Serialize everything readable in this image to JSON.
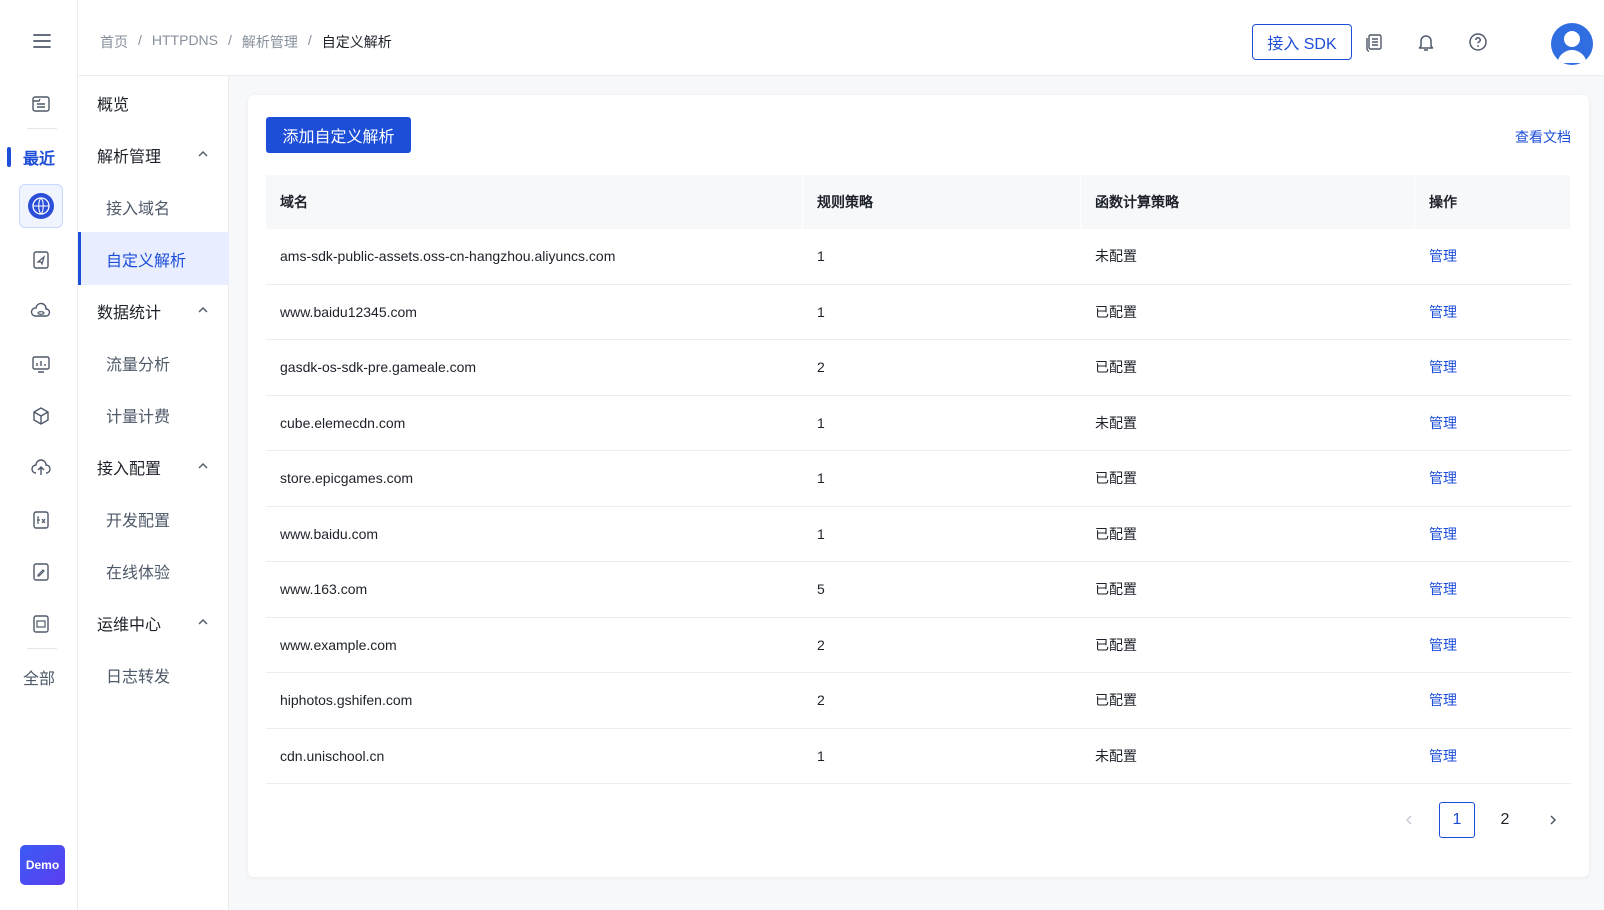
{
  "header": {
    "breadcrumb": [
      "首页",
      "HTTPDNS",
      "解析管理",
      "自定义解析"
    ],
    "sdk_button": "接入 SDK"
  },
  "rail": {
    "recent": "最近",
    "all": "全部",
    "demo": "Demo"
  },
  "subnav": {
    "overview": "概览",
    "groups": [
      {
        "label": "解析管理",
        "children": [
          "接入域名",
          "自定义解析"
        ]
      },
      {
        "label": "数据统计",
        "children": [
          "流量分析",
          "计量计费"
        ]
      },
      {
        "label": "接入配置",
        "children": [
          "开发配置",
          "在线体验"
        ]
      },
      {
        "label": "运维中心",
        "children": [
          "日志转发"
        ]
      }
    ]
  },
  "main": {
    "add_button": "添加自定义解析",
    "doc_link": "查看文档",
    "columns": [
      "域名",
      "规则策略",
      "函数计算策略",
      "操作"
    ],
    "rows": [
      {
        "domain": "ams-sdk-public-assets.oss-cn-hangzhou.aliyuncs.com",
        "rules": "1",
        "func": "未配置",
        "action": "管理"
      },
      {
        "domain": "www.baidu12345.com",
        "rules": "1",
        "func": "已配置",
        "action": "管理"
      },
      {
        "domain": "gasdk-os-sdk-pre.gameale.com",
        "rules": "2",
        "func": "已配置",
        "action": "管理"
      },
      {
        "domain": "cube.elemecdn.com",
        "rules": "1",
        "func": "未配置",
        "action": "管理"
      },
      {
        "domain": "store.epicgames.com",
        "rules": "1",
        "func": "已配置",
        "action": "管理"
      },
      {
        "domain": "www.baidu.com",
        "rules": "1",
        "func": "已配置",
        "action": "管理"
      },
      {
        "domain": "www.163.com",
        "rules": "5",
        "func": "已配置",
        "action": "管理"
      },
      {
        "domain": "www.example.com",
        "rules": "2",
        "func": "已配置",
        "action": "管理"
      },
      {
        "domain": "hiphotos.gshifen.com",
        "rules": "2",
        "func": "已配置",
        "action": "管理"
      },
      {
        "domain": "cdn.unischool.cn",
        "rules": "1",
        "func": "未配置",
        "action": "管理"
      }
    ],
    "pagination": {
      "pages": [
        "1",
        "2"
      ],
      "current": "1"
    }
  }
}
